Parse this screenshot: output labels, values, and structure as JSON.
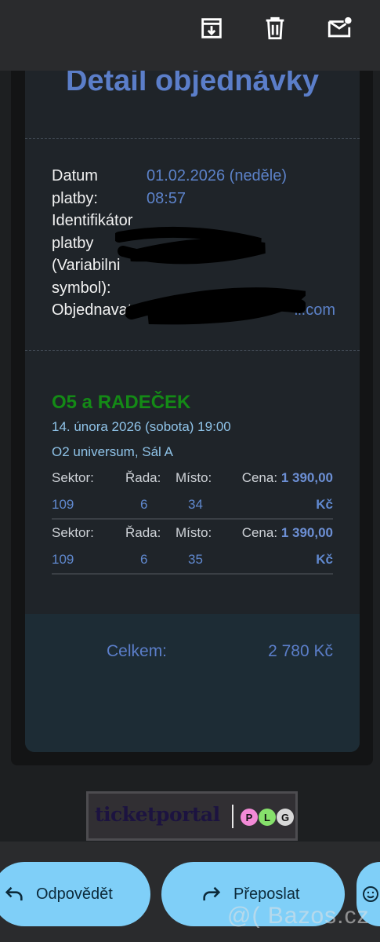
{
  "toolbar": {
    "archive_icon": "archive-icon",
    "delete_icon": "trash-icon",
    "mark_unread_icon": "mail-unread-icon"
  },
  "order": {
    "title": "Detail objednávky",
    "fields": [
      {
        "label": "Datum",
        "value": "01.02.2026 (neděle)"
      },
      {
        "label": "platby:",
        "value": "08:57"
      },
      {
        "label": "Identifikátor",
        "value": ""
      },
      {
        "label": "platby",
        "value": ""
      },
      {
        "label": "(Variabilni",
        "value": ""
      },
      {
        "label": "symbol):",
        "value": ""
      }
    ],
    "orderer_label": "Objednavatel:",
    "orderer_email_tail": "il.com"
  },
  "event": {
    "name": "O5 a RADEČEK",
    "datetime": "14. února 2026 (sobota) 19:00",
    "venue": "O2 universum, Sál A",
    "headers": {
      "sector": "Sektor:",
      "row": "Řada:",
      "seat": "Místo:",
      "price": "Cena:"
    },
    "tickets": [
      {
        "sector": "109",
        "row": "6",
        "seat": "34",
        "price": "1 390,00",
        "currency": "Kč"
      },
      {
        "sector": "109",
        "row": "6",
        "seat": "35",
        "price": "1 390,00",
        "currency": "Kč"
      }
    ]
  },
  "total": {
    "label": "Celkem:",
    "value": "2 780 Kč"
  },
  "logo": {
    "brand": "ticketportal",
    "badges": [
      "P",
      "L",
      "G"
    ],
    "badge_colors": [
      "#f28ad6",
      "#86e06b",
      "#d8d8d8"
    ]
  },
  "actions": {
    "reply": "Odpovědět",
    "forward": "Přeposlat",
    "emoji_icon": "emoji-icon"
  },
  "watermark": "@( Bazos.cz"
}
